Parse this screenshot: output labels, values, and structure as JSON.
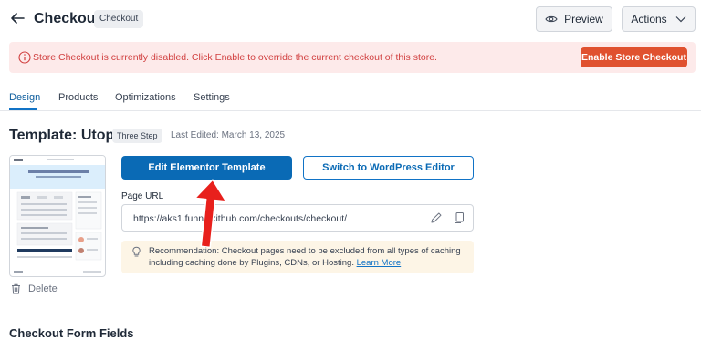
{
  "header": {
    "title": "Checkout",
    "badge": "Checkout",
    "preview_label": "Preview",
    "actions_label": "Actions"
  },
  "alert": {
    "message": "Store Checkout is currently disabled. Click Enable to override the current checkout of this store.",
    "button_label": "Enable Store Checkout"
  },
  "tabs": [
    {
      "label": "Design",
      "active": true
    },
    {
      "label": "Products",
      "active": false
    },
    {
      "label": "Optimizations",
      "active": false
    },
    {
      "label": "Settings",
      "active": false
    }
  ],
  "template": {
    "title": "Template: Utopia",
    "step_badge": "Three Step",
    "last_edited": "Last Edited: March 13, 2025",
    "delete_label": "Delete"
  },
  "editor_buttons": {
    "edit_elementor": "Edit Elementor Template",
    "switch_wordpress": "Switch to WordPress Editor"
  },
  "page_url": {
    "label": "Page URL",
    "value": "https://aks1.funnelkithub.com/checkouts/checkout/"
  },
  "recommendation": {
    "text": "Recommendation: Checkout pages need to be excluded from all types of caching including caching done by Plugins, CDNs, or Hosting.",
    "link_label": "Learn More"
  },
  "section": {
    "form_fields_title": "Checkout Form Fields"
  },
  "colors": {
    "primary": "#0a6ab5",
    "alert_bg": "#fdeaea",
    "alert_text": "#d13f3f",
    "enable_button": "#e0512f",
    "recommendation_bg": "#fdf5e6",
    "annotation_arrow": "#e8201c"
  },
  "icons": [
    "back-arrow-icon",
    "eye-icon",
    "chevron-down-icon",
    "info-circle-icon",
    "trash-icon",
    "pencil-icon",
    "copy-icon",
    "lightbulb-icon"
  ]
}
